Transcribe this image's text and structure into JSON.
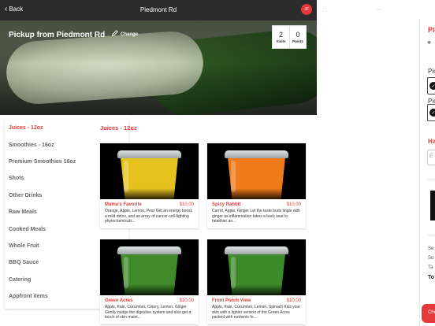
{
  "topbar": {
    "back_label": "Back",
    "title": "Piedmont Rd",
    "avatar_initials": "JF"
  },
  "hero": {
    "pickup_title": "Pickup from Piedmont Rd",
    "change_label": "Change",
    "stats": [
      {
        "value": "2",
        "label": "Visits"
      },
      {
        "value": "0",
        "label": "Points"
      }
    ]
  },
  "categories": [
    {
      "label": "Juices - 12oz",
      "active": true
    },
    {
      "label": "Smoothies - 16oz"
    },
    {
      "label": "Premium Smoothies 16oz"
    },
    {
      "label": "Shots"
    },
    {
      "label": "Other Drinks"
    },
    {
      "label": "Raw Meals"
    },
    {
      "label": "Cooked Meals"
    },
    {
      "label": "Whole Fruit"
    },
    {
      "label": "BBQ Sauce"
    },
    {
      "label": "Catering"
    },
    {
      "label": "Appfront items"
    }
  ],
  "section_title": "Juices - 12oz",
  "products": [
    {
      "name": "Mama's Favorite",
      "price": "$10.00",
      "color": "#e6c21f",
      "description": "Orange, Apple, Lemon, Pear Get an energy boost, a mild detox, and an array of cancer-cell-fighting phytochemicals..."
    },
    {
      "name": "Spicy Rabbit",
      "price": "$10.00",
      "color": "#f07a1a",
      "description": "Carrot, Apple, Ginger Let the taste buds tingle with ginger as inflammation takes a back seat to healthier an..."
    },
    {
      "name": "Green Acres",
      "price": "$10.00",
      "color": "#3f8a2a",
      "description": "Apple, Kale, Cucumber, Celery, Lemon, Ginger Gently nudge the digestive system and also get a touch of skin maint..."
    },
    {
      "name": "Front Porch View",
      "price": "$10.00",
      "color": "#3d8a2a",
      "description": "Apple, Kale, Cucumber, Lemon, Spinach Kiss your skin with a lighter version of the Green Acres packed with nutrients fo..."
    }
  ],
  "right_panel": {
    "heading": "Picku",
    "label_1": "Pic",
    "label_2": "Pic",
    "section": "Ha",
    "input_placeholder": "E",
    "summary": [
      "Se",
      "Su",
      "Ta",
      "To"
    ],
    "checkout_label": "Che"
  },
  "colors": {
    "accent": "#e33b3b",
    "topbar": "#2b2b2b"
  }
}
